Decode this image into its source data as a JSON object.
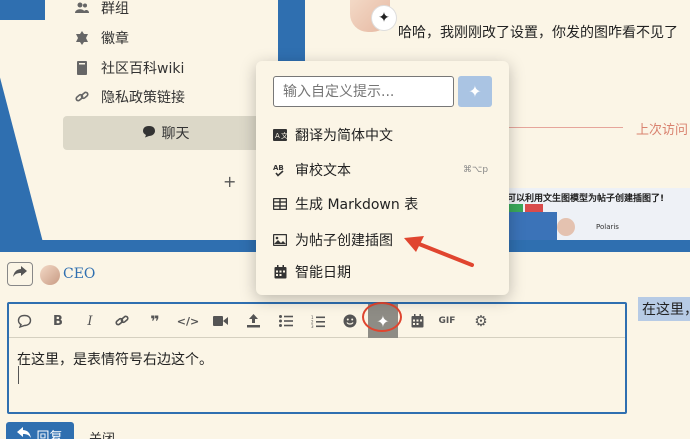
{
  "sidebar": {
    "items": [
      {
        "label": "群组",
        "icon": "users-icon"
      },
      {
        "label": "徽章",
        "icon": "badge-icon"
      },
      {
        "label": "社区百科wiki",
        "icon": "book-icon"
      },
      {
        "label": "隐私政策链接",
        "icon": "link-icon"
      }
    ],
    "chat_label": "聊天",
    "add_label": "+"
  },
  "chat": {
    "message": "哈哈，我刚刚改了设置，你发的图咋看不见了",
    "last_visit": "上次访问"
  },
  "embedded_image": {
    "title": "可以利用文生图模型为帖子创建插图了!",
    "user": "Polaris"
  },
  "ai_popup": {
    "placeholder": "输入自定义提示...",
    "items": [
      {
        "label": "翻译为简体中文",
        "icon": "translate-icon",
        "shortcut": ""
      },
      {
        "label": "审校文本",
        "icon": "spellcheck-icon",
        "shortcut": "⌘⌥p"
      },
      {
        "label": "生成 Markdown 表",
        "icon": "table-icon",
        "shortcut": ""
      },
      {
        "label": "为帖子创建插图",
        "icon": "image-icon",
        "shortcut": ""
      },
      {
        "label": "智能日期",
        "icon": "calendar-icon",
        "shortcut": ""
      }
    ]
  },
  "composer": {
    "reply_to": "CEO",
    "text": "在这里，是表情符号右边这个。",
    "reply_button": "回复",
    "close_button": "关闭",
    "preview_text": "在这里，",
    "gif_label": "GIF"
  },
  "colors": {
    "accent": "#2f6fb0",
    "annotation": "#e0452f",
    "background": "#fbf5e6"
  }
}
